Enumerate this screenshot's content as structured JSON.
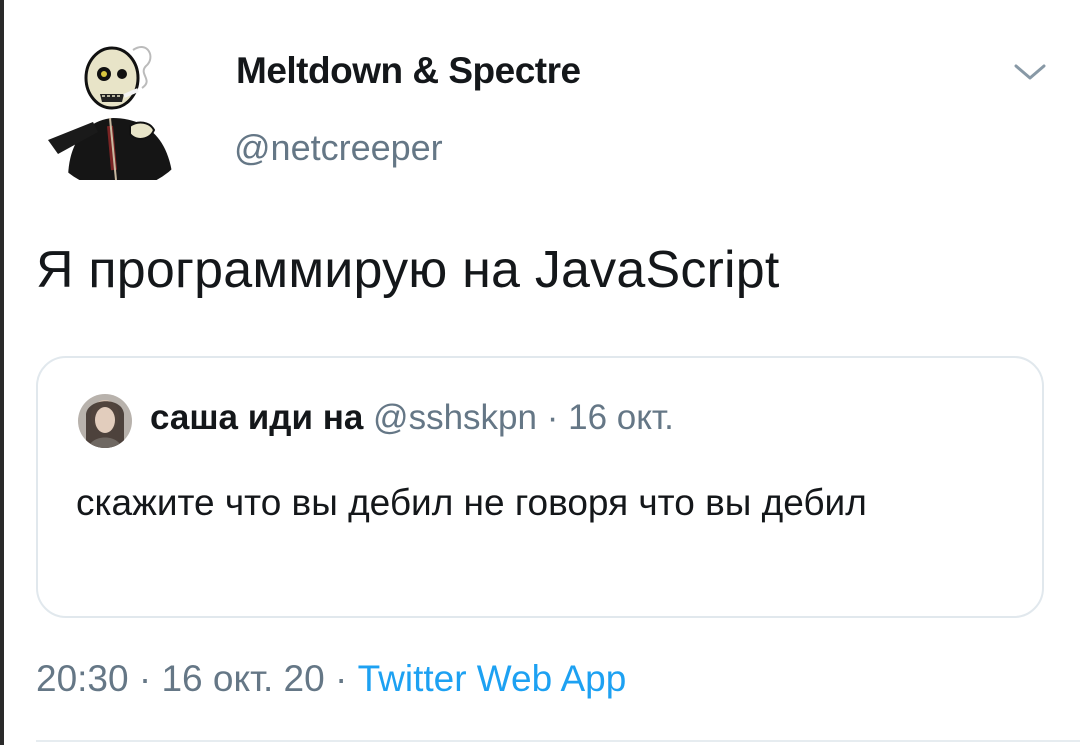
{
  "tweet": {
    "author": {
      "display_name": "Meltdown & Spectre",
      "handle": "@netcreeper"
    },
    "text": "Я программирую на JavaScript",
    "quoted": {
      "author_name": "саша иди на",
      "author_handle": "@sshskpn",
      "separator": "·",
      "date": "16 окт.",
      "text": "скажите что вы дебил не говоря что вы дебил"
    },
    "meta": {
      "time": "20:30",
      "separator1": "·",
      "date": "16 окт. 20",
      "separator2": "·",
      "source": "Twitter Web App"
    },
    "menu_icon": "chevron-down-icon"
  },
  "colors": {
    "text": "#14171a",
    "secondary": "#657786",
    "link": "#1da1f2",
    "border": "#e1e8ed"
  }
}
